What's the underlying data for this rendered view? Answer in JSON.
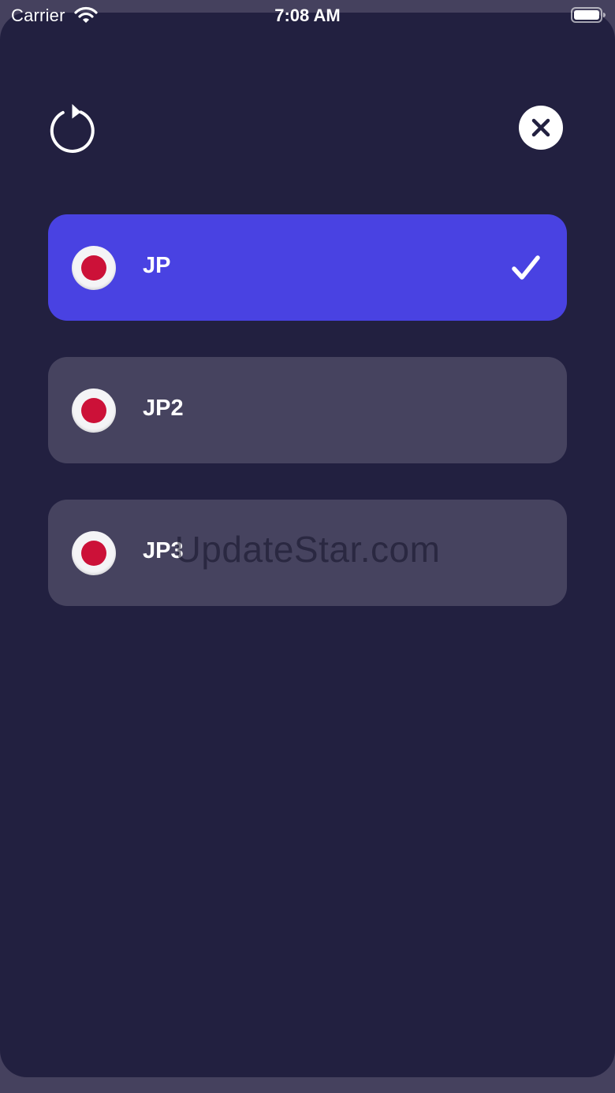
{
  "status_bar": {
    "carrier": "Carrier",
    "time": "7:08 AM",
    "wifi_icon": "wifi-icon",
    "battery_icon": "battery-icon"
  },
  "header": {
    "refresh_icon": "refresh-icon",
    "close_icon": "close-icon"
  },
  "servers": [
    {
      "name": "JP",
      "flag": "japan-flag-icon",
      "selected": true
    },
    {
      "name": "JP2",
      "flag": "japan-flag-icon",
      "selected": false
    },
    {
      "name": "JP3",
      "flag": "japan-flag-icon",
      "selected": false
    }
  ],
  "watermark": "UpdateStar.com",
  "colors": {
    "background": "#222040",
    "selected_item": "#4942e2",
    "item": "#46435f",
    "flag_red": "#cc1138"
  }
}
